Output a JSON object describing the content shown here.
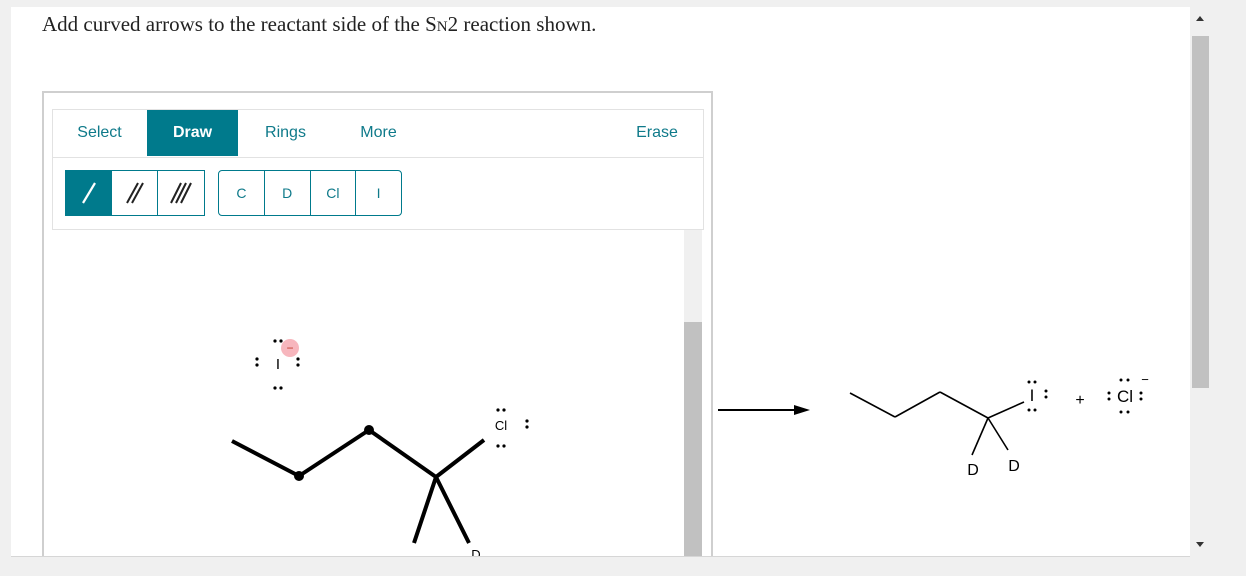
{
  "question": {
    "prefix": "Add curved arrows to the reactant side of the S",
    "subscript": "N",
    "suffix": "2 reaction shown."
  },
  "toolbar": {
    "tabs": [
      {
        "label": "Select"
      },
      {
        "label": "Draw",
        "active": true
      },
      {
        "label": "Rings"
      },
      {
        "label": "More"
      },
      {
        "label": "Erase"
      }
    ],
    "bond_tools": [
      "single-bond-icon",
      "double-bond-icon",
      "triple-bond-icon"
    ],
    "atoms": [
      "C",
      "D",
      "Cl",
      "I"
    ]
  },
  "reactant": {
    "nucleophile": {
      "symbol": "I",
      "charge": "−"
    },
    "leaving_group": {
      "symbol": "Cl"
    },
    "substituent_1": "D",
    "substituent_2": "D"
  },
  "product": {
    "iodine": "I",
    "plus": "+",
    "chloride": "Cl",
    "chloride_charge": "−",
    "d1": "D",
    "d2": "D"
  },
  "colors": {
    "accent": "#007a8c",
    "highlight": "#f7b6bd"
  }
}
